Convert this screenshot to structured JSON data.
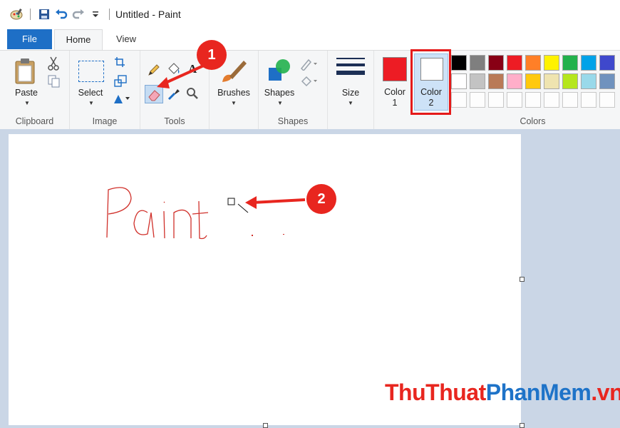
{
  "window": {
    "title": "Untitled - Paint"
  },
  "tabs": [
    {
      "label": "File"
    },
    {
      "label": "Home"
    },
    {
      "label": "View"
    }
  ],
  "ribbon": {
    "clipboard": {
      "group_label": "Clipboard",
      "paste_label": "Paste"
    },
    "image": {
      "group_label": "Image",
      "select_label": "Select"
    },
    "tools": {
      "group_label": "Tools"
    },
    "brushes": {
      "label": "Brushes"
    },
    "shapes": {
      "group_label": "Shapes",
      "shapes_label": "Shapes"
    },
    "size": {
      "label": "Size"
    },
    "colors": {
      "group_label": "Colors",
      "color1": {
        "label": "Color",
        "number": "1",
        "value": "#ed1c24"
      },
      "color2": {
        "label": "Color",
        "number": "2",
        "value": "#ffffff"
      },
      "palette_row1": [
        "#000000",
        "#7f7f7f",
        "#880015",
        "#ed1c24",
        "#ff7f27",
        "#fff200",
        "#22b14c",
        "#00a2e8",
        "#3f48cc"
      ],
      "palette_row2": [
        "#ffffff",
        "#c3c3c3",
        "#b97a57",
        "#ffaec9",
        "#ffc90e",
        "#efe4b0",
        "#b5e61d",
        "#99d9ea",
        "#7092be"
      ]
    }
  },
  "canvas": {
    "drawing_text": "Paint",
    "drawing_color": "#d0302a"
  },
  "annotations": {
    "callout1": "1",
    "callout2": "2",
    "accent": "#e8261f"
  },
  "watermark": {
    "part1": "ThuThuat",
    "part2": "PhanMem",
    "part3": ".vn",
    "color1": "#e8261f",
    "color2": "#1e73c8",
    "color3": "#e8261f"
  }
}
